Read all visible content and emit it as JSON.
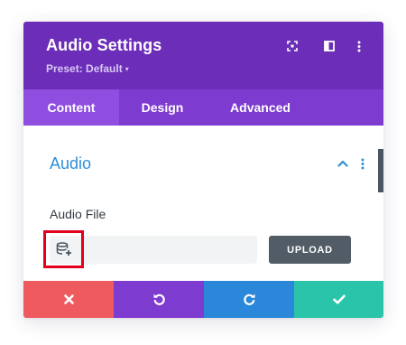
{
  "modal": {
    "title": "Audio Settings",
    "preset_label": "Preset: Default",
    "preset_caret": "▾",
    "header_icons": [
      "expand-icon",
      "split-view-icon",
      "more-vertical-icon"
    ]
  },
  "tabs": [
    {
      "label": "Content",
      "active": true
    },
    {
      "label": "Design",
      "active": false
    },
    {
      "label": "Advanced",
      "active": false
    }
  ],
  "section": {
    "title": "Audio",
    "collapse_icon": "chevron-up-icon",
    "menu_icon": "more-vertical-icon"
  },
  "audio_field": {
    "label": "Audio File",
    "value": "",
    "library_icon": "database-add-icon",
    "upload_label": "UPLOAD"
  },
  "footer": {
    "buttons": [
      {
        "name": "cancel",
        "icon": "close-icon",
        "color": "#ef5a5e"
      },
      {
        "name": "undo",
        "icon": "undo-icon",
        "color": "#7e3bd0"
      },
      {
        "name": "redo",
        "icon": "redo-icon",
        "color": "#2b87da"
      },
      {
        "name": "save",
        "icon": "check-icon",
        "color": "#29c4a9"
      }
    ]
  },
  "colors": {
    "header": "#6c2eb9",
    "tabs": "#7d3bcf",
    "active_tab": "#8f4ee0",
    "section_title": "#2e8fd9",
    "highlight_box": "#e0001b"
  }
}
